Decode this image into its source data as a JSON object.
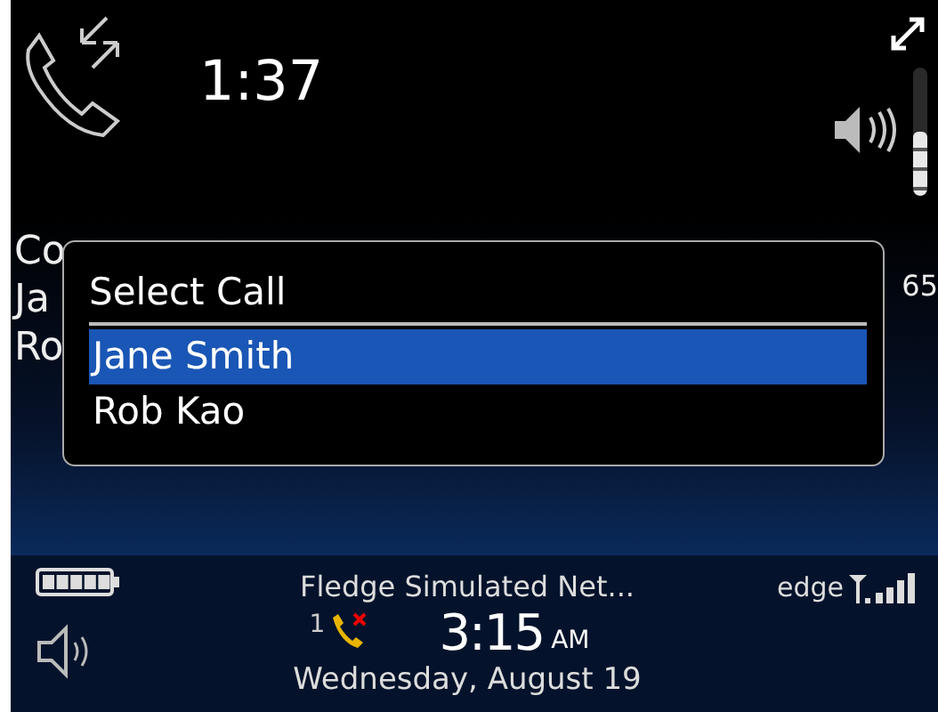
{
  "call": {
    "timer": "1:37",
    "volume": {
      "level": 0.5
    }
  },
  "call_info": {
    "lines": [
      "Co",
      "Ja",
      "Ro"
    ],
    "number": "65"
  },
  "dialog": {
    "title": "Select Call",
    "items": [
      {
        "label": "Jane Smith",
        "selected": true
      },
      {
        "label": "Rob Kao",
        "selected": false
      }
    ]
  },
  "status_bar": {
    "network": "Fledge Simulated Net...",
    "network_type": "edge",
    "missed_calls": "1",
    "time": "3:15",
    "meridiem": "AM",
    "date": "Wednesday, August 19"
  }
}
